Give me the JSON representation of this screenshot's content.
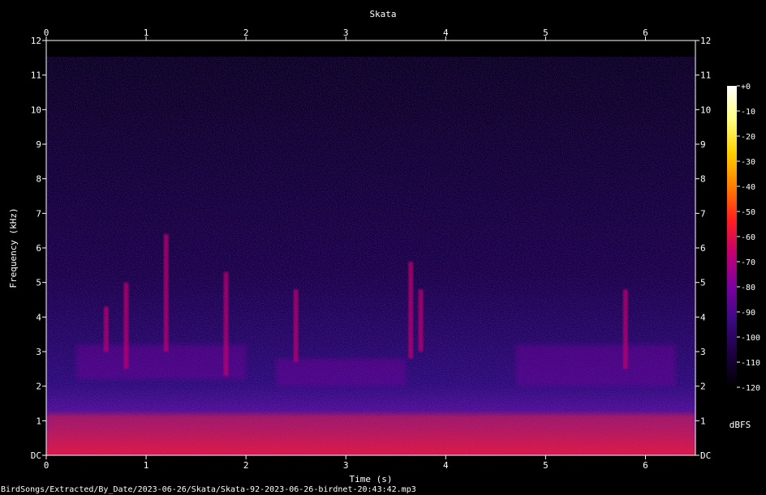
{
  "chart_data": {
    "type": "heatmap",
    "title": "Skata",
    "xlabel": "Time (s)",
    "ylabel": "Frequency (kHz)",
    "xlim": [
      0,
      6.5
    ],
    "ylim": [
      0,
      12
    ],
    "x_ticks": [
      "0",
      "1",
      "2",
      "3",
      "4",
      "5",
      "6"
    ],
    "y_ticks": [
      "DC",
      "1",
      "2",
      "3",
      "4",
      "5",
      "6",
      "7",
      "8",
      "9",
      "10",
      "11",
      "12"
    ],
    "colorbar": {
      "label": "dBFS",
      "range": [
        -120,
        0
      ],
      "ticks": [
        "+0",
        "-10",
        "-20",
        "-30",
        "-40",
        "-50",
        "-60",
        "-70",
        "-80",
        "-90",
        "-100",
        "-110",
        "-120"
      ],
      "colors": [
        "#000000",
        "#1c0040",
        "#3a0a80",
        "#7a00a0",
        "#c00070",
        "#ff2020",
        "#ff8000",
        "#ffd000",
        "#ffff80",
        "#ffffff"
      ]
    },
    "features": [
      {
        "kind": "low-band",
        "t0": 0,
        "t1": 6.5,
        "f0": 0,
        "f1": 1.2,
        "level": -55
      },
      {
        "kind": "band",
        "t0": 0.3,
        "t1": 2.0,
        "f0": 2.2,
        "f1": 3.2,
        "level": -75
      },
      {
        "kind": "band",
        "t0": 2.3,
        "t1": 3.6,
        "f0": 2.0,
        "f1": 2.8,
        "level": -85
      },
      {
        "kind": "band",
        "t0": 4.7,
        "t1": 6.3,
        "f0": 2.0,
        "f1": 3.2,
        "level": -75
      },
      {
        "kind": "call",
        "t": 0.6,
        "f0": 3.0,
        "f1": 4.3,
        "level": -70
      },
      {
        "kind": "call",
        "t": 0.8,
        "f0": 2.5,
        "f1": 5.0,
        "level": -70
      },
      {
        "kind": "call",
        "t": 1.2,
        "f0": 3.0,
        "f1": 6.4,
        "level": -70
      },
      {
        "kind": "call",
        "t": 1.8,
        "f0": 2.3,
        "f1": 5.3,
        "level": -70
      },
      {
        "kind": "call",
        "t": 2.5,
        "f0": 2.7,
        "f1": 4.8,
        "level": -70
      },
      {
        "kind": "call",
        "t": 3.65,
        "f0": 2.8,
        "f1": 5.6,
        "level": -70
      },
      {
        "kind": "call",
        "t": 3.75,
        "f0": 3.0,
        "f1": 4.8,
        "level": -70
      },
      {
        "kind": "call",
        "t": 5.8,
        "f0": 2.5,
        "f1": 4.8,
        "level": -70
      }
    ]
  },
  "footer": {
    "path": "BirdSongs/Extracted/By_Date/2023-06-26/Skata/Skata-92-2023-06-26-birdnet-20:43:42.mp3"
  }
}
